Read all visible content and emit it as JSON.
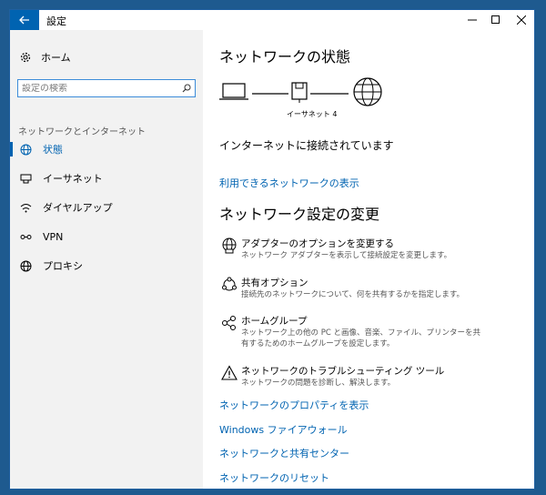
{
  "window": {
    "title": "設定"
  },
  "sidebar": {
    "home_label": "ホーム",
    "search_placeholder": "設定の検索",
    "section_title": "ネットワークとインターネット",
    "items": [
      {
        "label": "状態",
        "icon": "globe-status-icon",
        "active": true
      },
      {
        "label": "イーサネット",
        "icon": "ethernet-icon",
        "active": false
      },
      {
        "label": "ダイヤルアップ",
        "icon": "dialup-icon",
        "active": false
      },
      {
        "label": "VPN",
        "icon": "vpn-icon",
        "active": false
      },
      {
        "label": "プロキシ",
        "icon": "proxy-globe-icon",
        "active": false
      }
    ]
  },
  "main": {
    "status_heading": "ネットワークの状態",
    "adapter_label": "イーサネット 4",
    "connection_status": "インターネットに接続されています",
    "show_networks_link": "利用できるネットワークの表示",
    "change_heading": "ネットワーク設定の変更",
    "options": [
      {
        "title": "アダプターのオプションを変更する",
        "desc": "ネットワーク アダプターを表示して接続設定を変更します。",
        "icon": "adapter-icon"
      },
      {
        "title": "共有オプション",
        "desc": "接続先のネットワークについて、何を共有するかを指定します。",
        "icon": "sharing-icon"
      },
      {
        "title": "ホームグループ",
        "desc": "ネットワーク上の他の PC と画像、音楽、ファイル、プリンターを共有するためのホームグループを設定します。",
        "icon": "homegroup-icon"
      },
      {
        "title": "ネットワークのトラブルシューティング ツール",
        "desc": "ネットワークの問題を診断し、解決します。",
        "icon": "warning-icon"
      }
    ],
    "links": [
      "ネットワークのプロパティを表示",
      "Windows ファイアウォール",
      "ネットワークと共有センター",
      "ネットワークのリセット"
    ]
  },
  "colors": {
    "accent": "#0063b1",
    "sidebar_bg": "#f2f2f2",
    "desktop": "#1e5a8f"
  }
}
